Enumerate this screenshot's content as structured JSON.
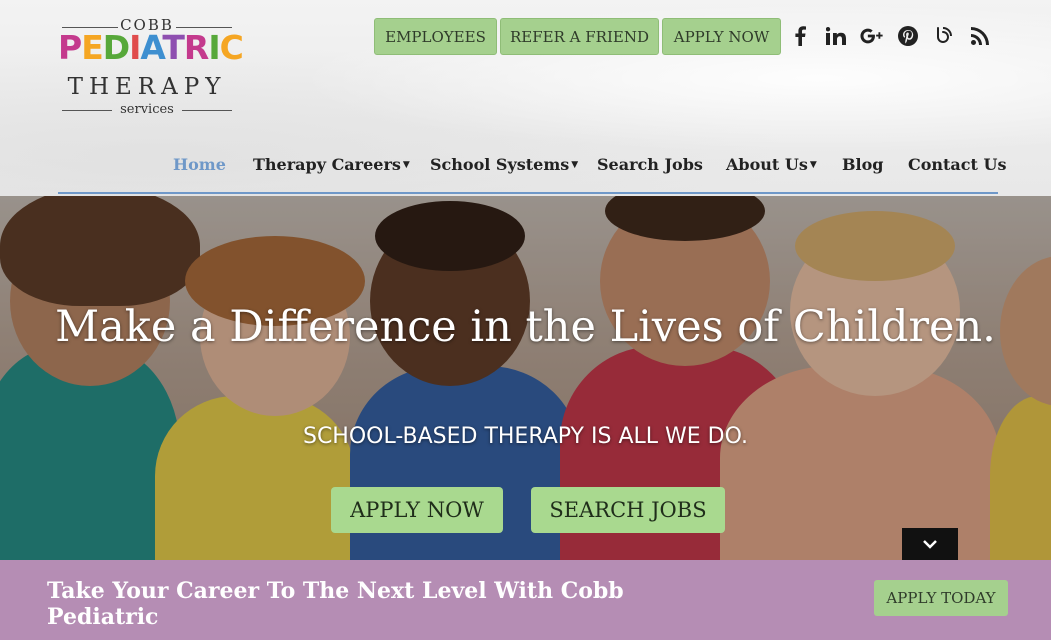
{
  "logo": {
    "cobb": "COBB",
    "pediatric": "PEDIATRIC",
    "therapy": "THERAPY",
    "services": "services",
    "letter_colors": [
      "#c43a8d",
      "#f5a623",
      "#57a83a",
      "#e04c4c",
      "#3e8fd0",
      "#8e4fb0",
      "#c43a8d",
      "#57a83a",
      "#f5a623"
    ]
  },
  "top_buttons": [
    {
      "label": "EMPLOYEES"
    },
    {
      "label": "REFER A FRIEND"
    },
    {
      "label": "APPLY NOW"
    }
  ],
  "social": [
    {
      "icon": "facebook-icon",
      "glyph": "f"
    },
    {
      "icon": "linkedin-icon",
      "glyph": "in"
    },
    {
      "icon": "google-plus-icon",
      "glyph": "G+"
    },
    {
      "icon": "pinterest-icon",
      "glyph": "℗"
    },
    {
      "icon": "blogger-icon",
      "glyph": "ʚ"
    },
    {
      "icon": "rss-icon",
      "glyph": "◝"
    }
  ],
  "nav": {
    "items": [
      {
        "label": "Home",
        "active": true,
        "dropdown": false
      },
      {
        "label": "Therapy Careers",
        "active": false,
        "dropdown": true
      },
      {
        "label": "School Systems",
        "active": false,
        "dropdown": true
      },
      {
        "label": "Search Jobs",
        "active": false,
        "dropdown": false
      },
      {
        "label": "About Us",
        "active": false,
        "dropdown": true
      },
      {
        "label": "Blog",
        "active": false,
        "dropdown": false
      },
      {
        "label": "Contact Us",
        "active": false,
        "dropdown": false
      }
    ],
    "active_color": "#6f98c8"
  },
  "hero": {
    "title": "Make a Difference in the Lives of Children.",
    "subtitle": "SCHOOL-BASED THERAPY IS ALL WE DO.",
    "apply_label": "APPLY NOW",
    "search_label": "SEARCH JOBS"
  },
  "cta": {
    "text": "Take Your Career To The Next Level With Cobb Pediatric",
    "button_label": "APPLY TODAY",
    "bar_color": "#b58db4",
    "button_color": "#a5d08e"
  }
}
